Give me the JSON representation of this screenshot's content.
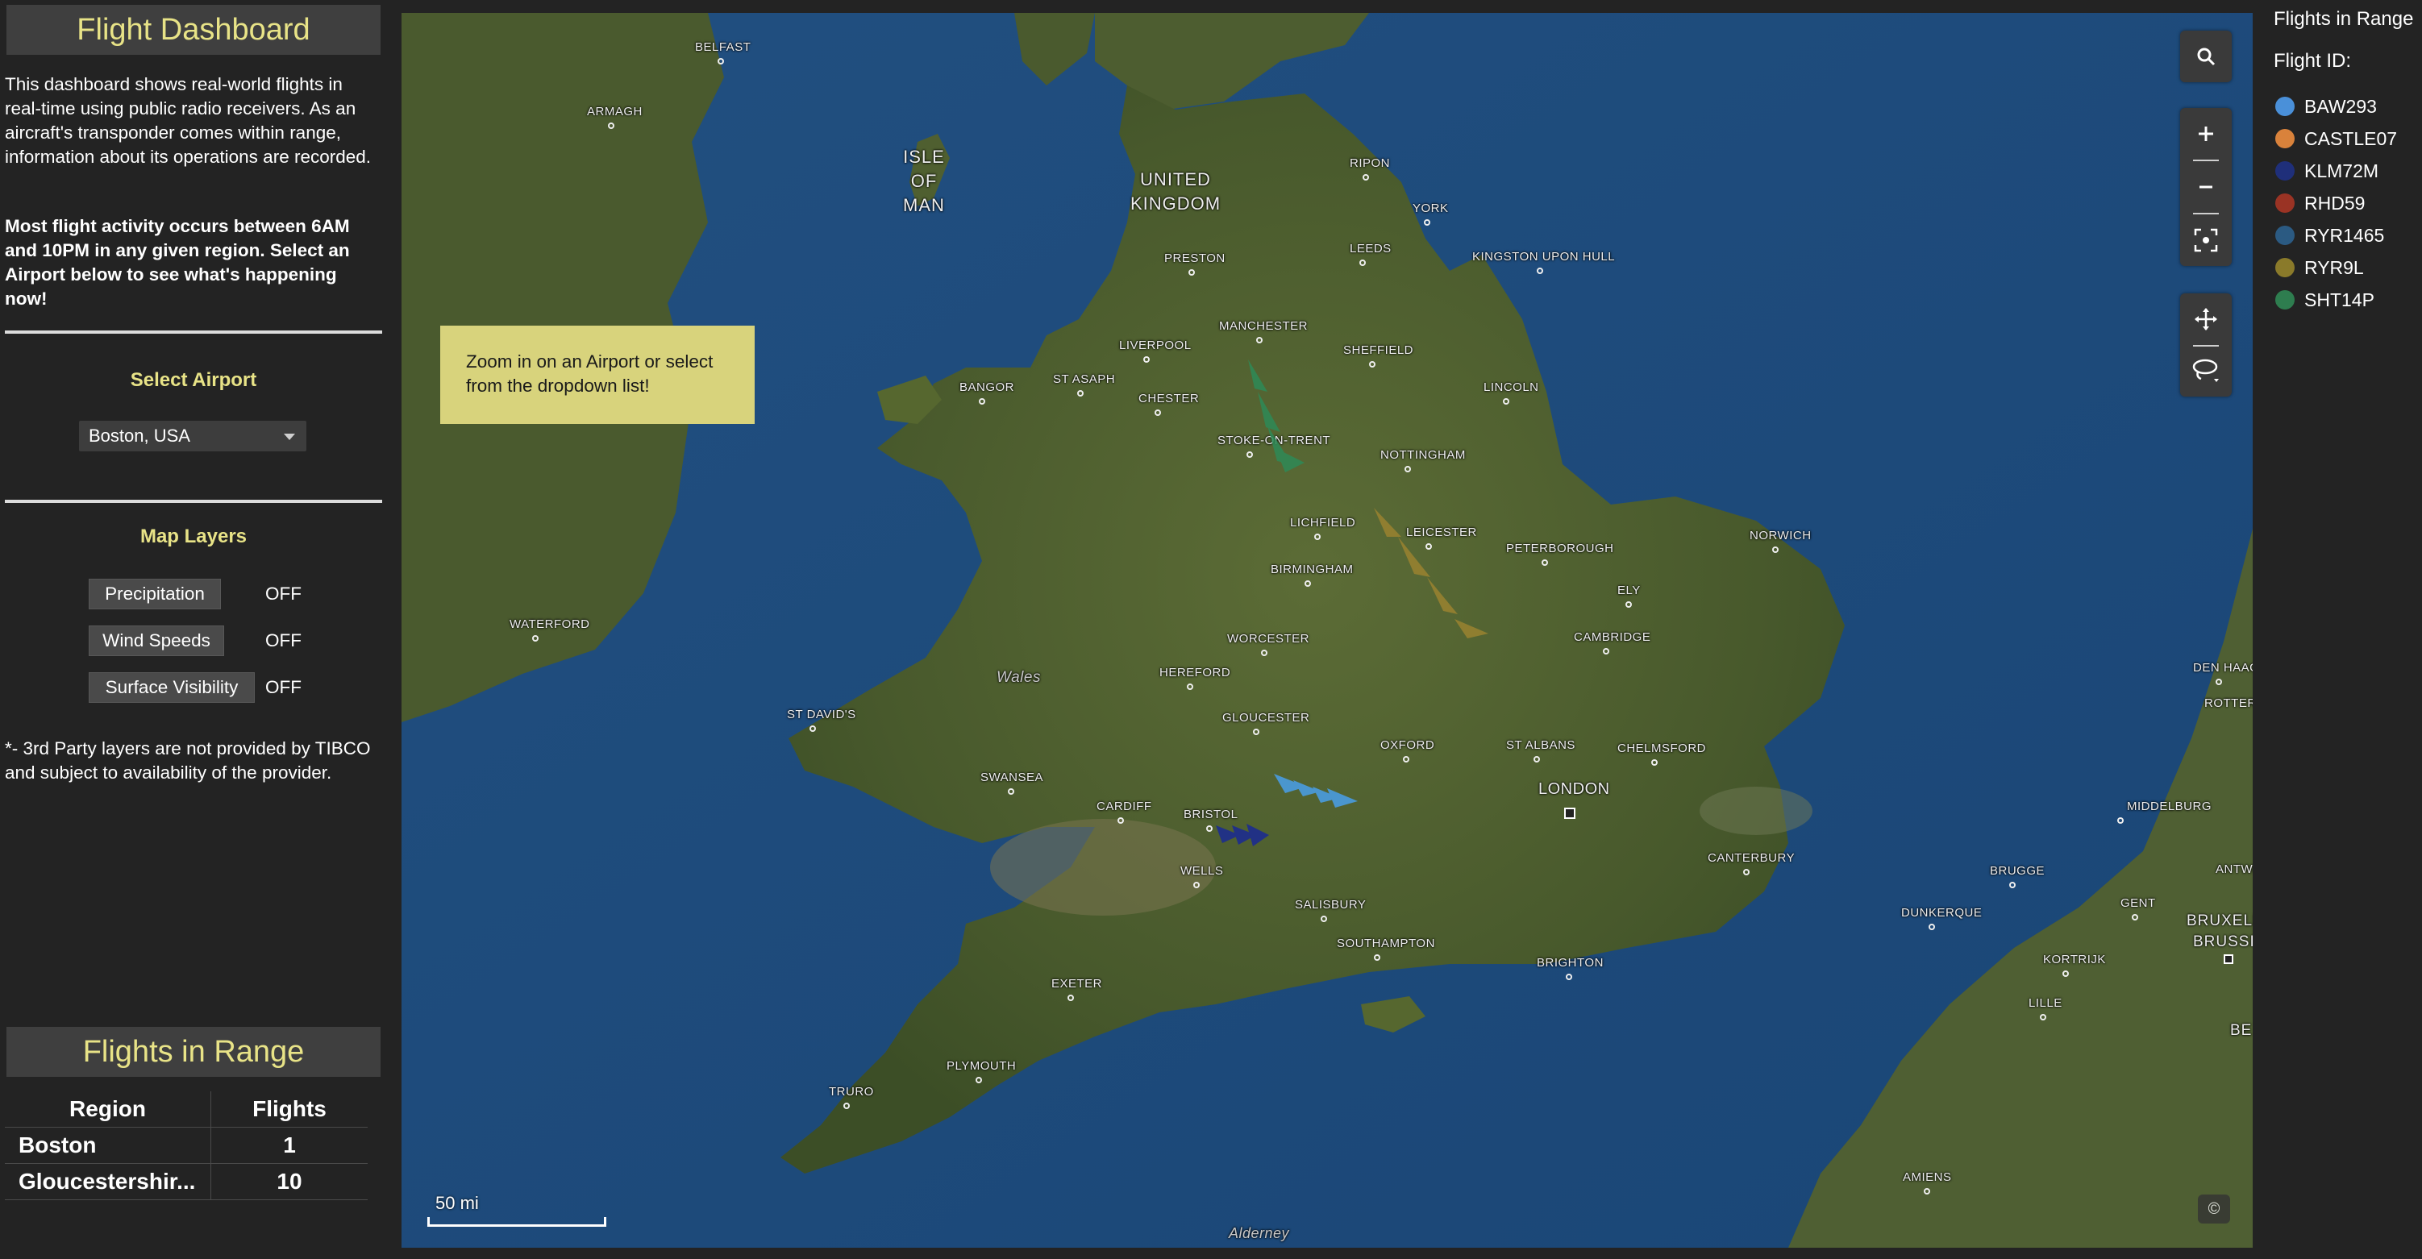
{
  "dashboard": {
    "title": "Flight Dashboard",
    "intro": "This dashboard shows real-world flights in real-time using public radio receivers. As an aircraft's transponder comes within range, information about its operations are recorded.",
    "intro_bold": "Most flight activity occurs between 6AM and 10PM in any given region. Select an Airport below to see what's happening now!"
  },
  "airport": {
    "label": "Select Airport",
    "selected": "Boston, USA"
  },
  "map_layers": {
    "label": "Map Layers",
    "items": [
      {
        "label": "Precipitation",
        "state": "OFF"
      },
      {
        "label": "Wind Speeds",
        "state": "OFF"
      },
      {
        "label": "Surface Visibility",
        "state": "OFF"
      }
    ],
    "disclaimer": "*- 3rd Party layers are not provided by TIBCO and subject to availability of the provider."
  },
  "flights_in_range": {
    "title": "Flights in Range",
    "headers": [
      "Region",
      "Flights"
    ],
    "rows": [
      {
        "region": "Boston",
        "flights": "1"
      },
      {
        "region": "Gloucestershir...",
        "flights": "10"
      }
    ]
  },
  "map": {
    "callout": "Zoom in on an Airport or select from the dropdown list!",
    "scale": "50 mi",
    "copyright": "©",
    "places": {
      "belfast": "BELFAST",
      "armagh": "ARMAGH",
      "isle_of_man": "ISLE OF MAN",
      "united_kingdom": "UNITED KINGDOM",
      "ripon": "RIPON",
      "york": "YORK",
      "preston": "PRESTON",
      "leeds": "LEEDS",
      "kingston": "KINGSTON UPON HULL",
      "liverpool": "LIVERPOOL",
      "manchester": "MANCHESTER",
      "sheffield": "SHEFFIELD",
      "bangor": "BANGOR",
      "st_asaph": "ST ASAPH",
      "chester": "CHESTER",
      "lincoln": "LINCOLN",
      "stoke": "STOKE-ON-TRENT",
      "nottingham": "NOTTINGHAM",
      "lichfield": "LICHFIELD",
      "leicester": "LEICESTER",
      "norwich": "NORWICH",
      "peterborough": "PETERBOROUGH",
      "birmingham": "BIRMINGHAM",
      "ely": "ELY",
      "waterford": "WATERFORD",
      "worcester": "WORCESTER",
      "cambridge": "CAMBRIDGE",
      "wales": "Wales",
      "hereford": "HEREFORD",
      "st_davids": "ST DAVID'S",
      "gloucester": "GLOUCESTER",
      "oxford": "OXFORD",
      "st_albans": "ST ALBANS",
      "chelmsford": "CHELMSFORD",
      "swansea": "SWANSEA",
      "london": "LONDON",
      "cardiff": "CARDIFF",
      "bristol": "BRISTOL",
      "canterbury": "CANTERBURY",
      "wells": "WELLS",
      "salisbury": "SALISBURY",
      "southampton": "SOUTHAMPTON",
      "brighton": "BRIGHTON",
      "exeter": "EXETER",
      "plymouth": "PLYMOUTH",
      "truro": "TRURO",
      "dunkerque": "DUNKERQUE",
      "brugge": "BRUGGE",
      "gent": "GENT",
      "kortrijk": "KORTRIJK",
      "lille": "LILLE",
      "middelburg": "MIDDELBURG",
      "den_haag": "DEN HAAG",
      "rotter": "ROTTER",
      "antwerp": "ANTWER",
      "bruxelles": "BRUXELL",
      "brussel": "BRUSSI",
      "be": "BE",
      "amiens": "AMIENS",
      "alderney": "Alderney"
    }
  },
  "legend": {
    "title": "Flights in Range",
    "subtitle": "Flight ID:",
    "items": [
      {
        "id": "BAW293",
        "color": "#4a90d9"
      },
      {
        "id": "CASTLE07",
        "color": "#d9823b"
      },
      {
        "id": "KLM72M",
        "color": "#1f2f7a"
      },
      {
        "id": "RHD59",
        "color": "#9a3324"
      },
      {
        "id": "RYR1465",
        "color": "#2b5a82"
      },
      {
        "id": "RYR9L",
        "color": "#8a7a2a"
      },
      {
        "id": "SHT14P",
        "color": "#2e7d4f"
      }
    ]
  }
}
